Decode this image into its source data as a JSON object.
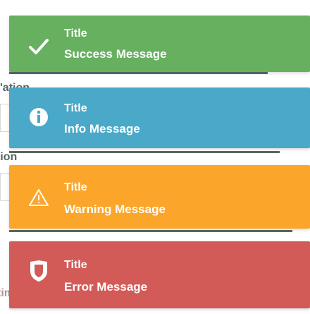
{
  "background_fragments": {
    "frag1": "'ation",
    "frag2": "ation",
    "frag3": "time out"
  },
  "toasts": [
    {
      "type": "success",
      "title": "Title",
      "message": "Success Message",
      "color": "#66b05f",
      "icon": "check-icon"
    },
    {
      "type": "info",
      "title": "Title",
      "message": "Info Message",
      "color": "#4aa8c8",
      "icon": "info-icon"
    },
    {
      "type": "warning",
      "title": "Title",
      "message": "Warning Message",
      "color": "#fba62a",
      "icon": "warning-icon"
    },
    {
      "type": "error",
      "title": "Title",
      "message": "Error Message",
      "color": "#d25b58",
      "icon": "shield-icon"
    }
  ]
}
